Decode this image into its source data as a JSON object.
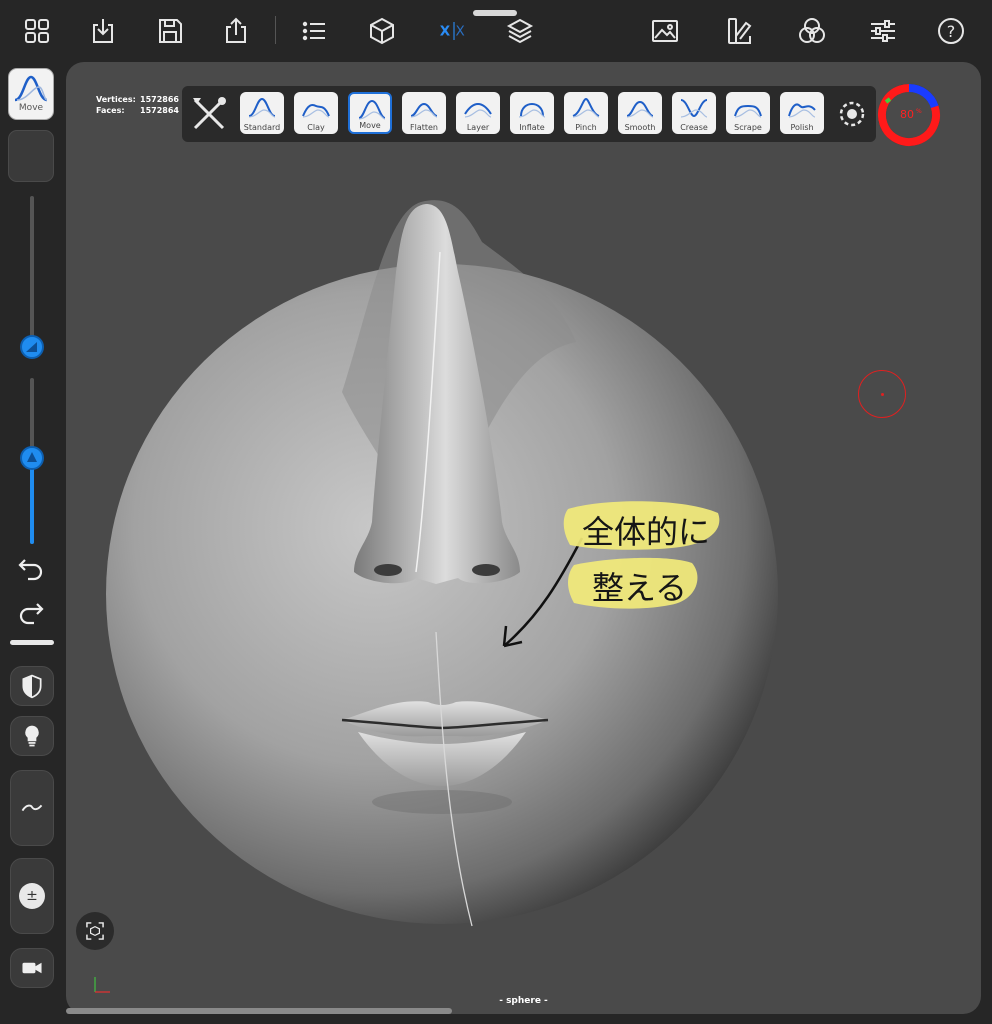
{
  "toolbar": {
    "icons": [
      "grid-icon",
      "download-icon",
      "save-icon",
      "share-icon",
      "list-icon",
      "cube-icon",
      "symmetry-icon",
      "layers-icon",
      "image-icon",
      "palette-icon",
      "color-circles-icon",
      "sliders-icon",
      "help-icon"
    ],
    "symmetry_label": "X|X",
    "help_label": "?"
  },
  "left_panel": {
    "active_tool": "Move",
    "size_slider_level": 0.07,
    "intensity_slider_level": 0.52,
    "symbol_plusminus": "±",
    "icons": [
      "undo-icon",
      "redo-icon",
      "shield-icon",
      "bulb-icon",
      "wave-icon",
      "plusminus-icon",
      "camera-icon"
    ]
  },
  "stats": {
    "vertices_label": "Vertices:",
    "vertices": "1572866",
    "faces_label": "Faces:",
    "faces": "1572864"
  },
  "brushes": [
    {
      "name": "Standard",
      "selected": false
    },
    {
      "name": "Clay",
      "selected": false
    },
    {
      "name": "Move",
      "selected": true
    },
    {
      "name": "Flatten",
      "selected": false
    },
    {
      "name": "Layer",
      "selected": false
    },
    {
      "name": "Inflate",
      "selected": false
    },
    {
      "name": "Pinch",
      "selected": false
    },
    {
      "name": "Smooth",
      "selected": false
    },
    {
      "name": "Crease",
      "selected": false
    },
    {
      "name": "Scrape",
      "selected": false
    },
    {
      "name": "Polish",
      "selected": false
    }
  ],
  "gauge": {
    "percent_text": "80",
    "percent_suffix": "%",
    "value": 0.8
  },
  "annotation": {
    "line1": "全体的に",
    "line2": "整える"
  },
  "object_name": "- sphere -",
  "colors": {
    "accent": "#1f8cf0",
    "gauge_red": "#ff1a1a",
    "gauge_blue": "#1a3cff",
    "highlight": "#f2ea7a",
    "viewport": "#4a4a4a"
  }
}
